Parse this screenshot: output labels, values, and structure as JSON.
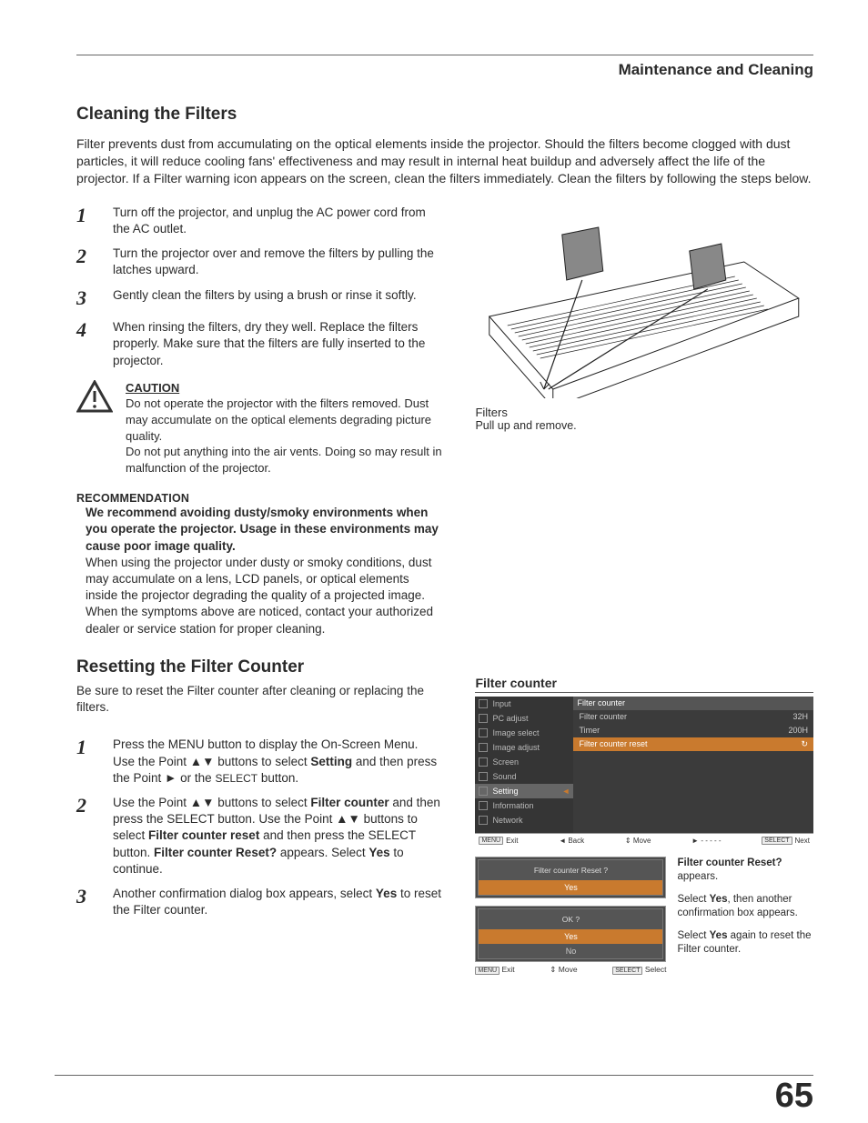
{
  "header": {
    "section": "Maintenance and Cleaning"
  },
  "section1": {
    "title": "Cleaning the Filters",
    "intro": "Filter prevents dust from accumulating on the optical elements inside the projector. Should the filters become clogged with dust particles, it will reduce cooling fans' effectiveness and may result in internal heat buildup and adversely affect the life of the projector. If a Filter warning icon appears on the screen, clean the filters immediately. Clean the filters by following the steps below.",
    "steps": {
      "n1": "1",
      "t1": "Turn off the projector, and unplug the AC power cord from the AC outlet.",
      "n2": "2",
      "t2": "Turn the projector over and remove the filters by pulling the latches upward.",
      "n3": "3",
      "t3": "Gently clean the filters by using a brush or rinse it softly.",
      "n4": "4",
      "t4": "When rinsing the filters, dry they well. Replace the filters properly. Make sure that the filters are fully inserted to the projector."
    },
    "caution": {
      "title": "CAUTION",
      "p1": "Do not operate the projector with the filters removed. Dust may accumulate on the optical elements degrading picture quality.",
      "p2": "Do not put anything into the air vents. Doing so may result in malfunction of the projector."
    },
    "rec": {
      "title": "RECOMMENDATION",
      "bold": "We recommend avoiding dusty/smoky environments when you operate the projector. Usage in these environments may cause poor image quality.",
      "body": "When using the projector under dusty or smoky conditions, dust may accumulate on a lens, LCD panels, or optical elements inside the projector degrading the quality of a projected image. When the symptoms above are noticed, contact your authorized dealer or service station for proper cleaning."
    },
    "illus": {
      "cap1": "Filters",
      "cap2": "Pull up and remove."
    }
  },
  "section2": {
    "title": "Resetting the Filter Counter",
    "sub": "Be sure to reset the Filter counter after cleaning or replacing the filters.",
    "steps": {
      "n1": "1",
      "t1a": "Press the MENU button to display the On-Screen Menu. Use the Point ▲▼ buttons to select ",
      "t1b": "Setting",
      "t1c": " and then press the Point ► or the ",
      "t1d": "SELECT",
      "t1e": " button.",
      "n2": "2",
      "t2a": "Use the Point ▲▼ buttons to select ",
      "t2b": "Filter counter",
      "t2c": " and then press the SELECT button. Use the Point ▲▼ buttons to select ",
      "t2d": "Filter counter reset",
      "t2e": " and then press the SELECT button. ",
      "t2f": "Filter counter Reset?",
      "t2g": " appears. Select ",
      "t2h": "Yes",
      "t2i": " to continue.",
      "n3": "3",
      "t3a": "Another confirmation dialog box appears, select ",
      "t3b": "Yes",
      "t3c": " to reset the Filter counter."
    }
  },
  "osd": {
    "title": "Filter counter",
    "menu": {
      "m1": "Input",
      "m2": "PC adjust",
      "m3": "Image select",
      "m4": "Image adjust",
      "m5": "Screen",
      "m6": "Sound",
      "m7": "Setting",
      "m8": "Information",
      "m9": "Network"
    },
    "panel": {
      "head": "Filter counter",
      "r1l": "Filter counter",
      "r1r": "32H",
      "r2l": "Timer",
      "r2r": "200H",
      "r3": "Filter counter reset"
    },
    "foot": {
      "k1": "MENU",
      "f1": "Exit",
      "f2": "◄ Back",
      "f3": "⇕ Move",
      "f4": "► - - - - -",
      "k2": "SELECT",
      "f5": "Next"
    },
    "confirm1": {
      "t": "Filter counter  Reset ?",
      "opt": "Yes"
    },
    "confirm2": {
      "t": "OK ?",
      "opt1": "Yes",
      "opt2": "No"
    },
    "cfoot": {
      "k1": "MENU",
      "f1": "Exit",
      "f2": "⇕ Move",
      "k2": "SELECT",
      "f3": "Select"
    },
    "side": {
      "p1a": "Filter counter Reset?",
      "p1b": " appears.",
      "p2a": "Select ",
      "p2b": "Yes",
      "p2c": ", then another confirmation box appears.",
      "p3a": "Select ",
      "p3b": "Yes",
      "p3c": " again to reset the Filter counter."
    }
  },
  "page_number": "65"
}
